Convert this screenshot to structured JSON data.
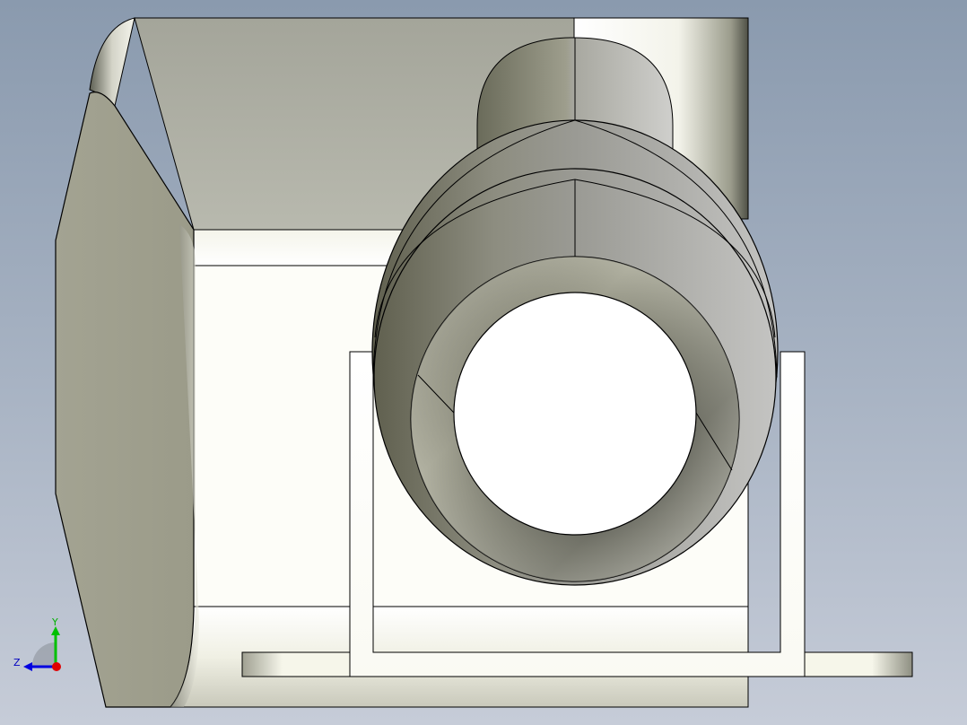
{
  "viewport": {
    "background_top": "#8a9aae",
    "background_bottom": "#c6ccd8",
    "part_face_color": "#fdfdf6",
    "part_edge_color": "#000000",
    "part_shade_dark": "#54564c",
    "part_shade_mid": "#9c9c8a",
    "part_shade_light": "#e9e9e0"
  },
  "triad": {
    "y_label": "Y",
    "z_label": "Z",
    "y_color": "#00c000",
    "z_color": "#0000e0",
    "x_dot_color": "#e00000"
  }
}
